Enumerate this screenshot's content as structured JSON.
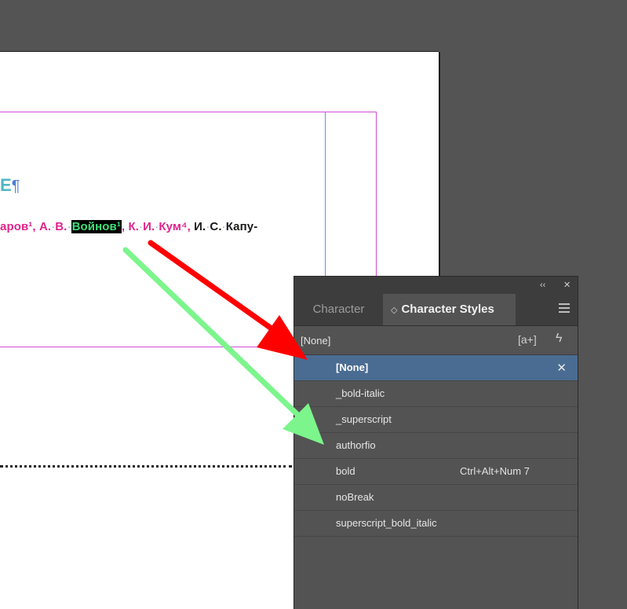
{
  "document": {
    "heading_fragment": "Е",
    "pilcrow": "¶",
    "authors": {
      "part1": "аров¹,",
      "part2": "А.",
      "part3": "В.",
      "selected_name": "Войнов¹",
      "part4": ",",
      "part5": "К.",
      "part6": "И.",
      "part7": "Кум⁴,",
      "part8": "И.",
      "part9": "С.",
      "part10": "Капу-"
    }
  },
  "panel": {
    "tab_character": "Character",
    "tab_character_styles": "Character Styles",
    "collapse_glyph": "‹‹",
    "close_glyph": "✕",
    "current_style": "[None]",
    "new_style_glyph": "[a+]",
    "bolt_glyph": "ϟ",
    "updown_glyph": "◇",
    "pin_glyph": "✕",
    "styles": [
      {
        "name": "[None]",
        "shortcut": ""
      },
      {
        "name": "_bold-italic",
        "shortcut": ""
      },
      {
        "name": "_superscript",
        "shortcut": ""
      },
      {
        "name": "authorfio",
        "shortcut": ""
      },
      {
        "name": "bold",
        "shortcut": "Ctrl+Alt+Num 7"
      },
      {
        "name": "noBreak",
        "shortcut": ""
      },
      {
        "name": "superscript_bold_italic",
        "shortcut": ""
      }
    ],
    "selected_index": 0
  },
  "colors": {
    "selection": "#4a6c92",
    "arrow_red": "#ff0000",
    "arrow_green": "#7cf58c",
    "author_magenta": "#e0248c",
    "highlight_green": "#3fe07a"
  }
}
